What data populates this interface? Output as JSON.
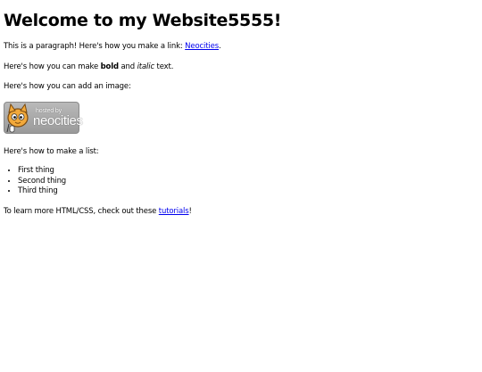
{
  "heading": "Welcome to my Website5555!",
  "p1": {
    "before": "This is a paragraph! Here's how you make a link: ",
    "link": "Neocities",
    "after": "."
  },
  "p2": {
    "before": "Here's how you can make ",
    "bold": "bold",
    "middle": " and ",
    "italic": "italic",
    "after": " text."
  },
  "p3": "Here's how you can add an image:",
  "badge": {
    "small": "hosted by",
    "big": "neocities",
    "alt": "Site hosted by Neocities"
  },
  "p4": "Here's how to make a list:",
  "list": [
    "First thing",
    "Second thing",
    "Third thing"
  ],
  "p5": {
    "before": "To learn more HTML/CSS, check out these ",
    "link": "tutorials",
    "after": "!"
  },
  "colors": {
    "link": "#0000ee",
    "text": "#000000",
    "background": "#ffffff"
  },
  "icons": {
    "badge": "neocities-cat-icon"
  }
}
